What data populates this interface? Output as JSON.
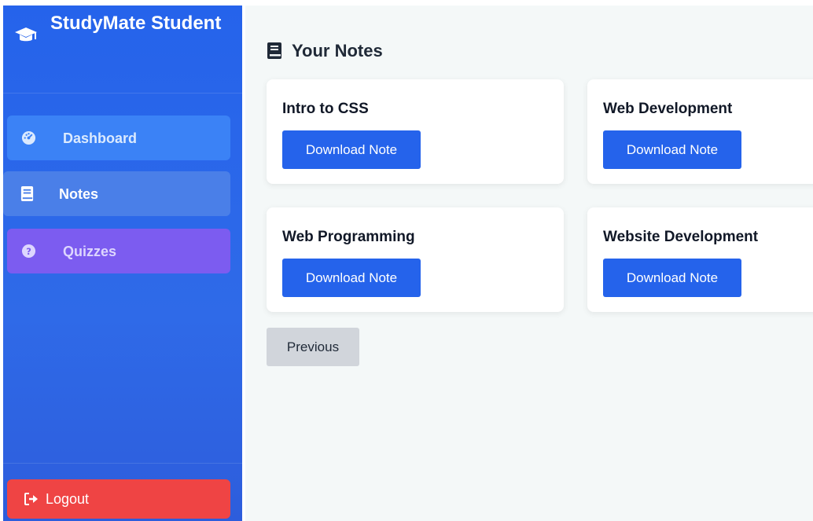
{
  "sidebar": {
    "brand": {
      "title": "StudyMate Student",
      "icon": "graduation-cap-icon"
    },
    "items": [
      {
        "label": "Dashboard",
        "icon": "gauge-icon",
        "color": "#3b82f6"
      },
      {
        "label": "Notes",
        "icon": "book-icon",
        "color": "#4a7fe8",
        "active": true
      },
      {
        "label": "Quizzes",
        "icon": "question-circle-icon",
        "color": "#7c5cf0"
      }
    ],
    "logout": {
      "label": "Logout",
      "icon": "sign-out-icon",
      "color": "#ef4444"
    }
  },
  "main": {
    "title": "Your Notes",
    "title_icon": "book-icon",
    "notes": [
      {
        "title": "Intro to CSS",
        "button": "Download Note"
      },
      {
        "title": "Web Development",
        "button": "Download Note"
      },
      {
        "title": "Web Programming",
        "button": "Download Note"
      },
      {
        "title": "Website Development",
        "button": "Download Note"
      }
    ],
    "pagination": {
      "previous_label": "Previous"
    }
  },
  "colors": {
    "primary": "#2563eb",
    "danger": "#ef4444",
    "background": "#f4f8f8"
  }
}
